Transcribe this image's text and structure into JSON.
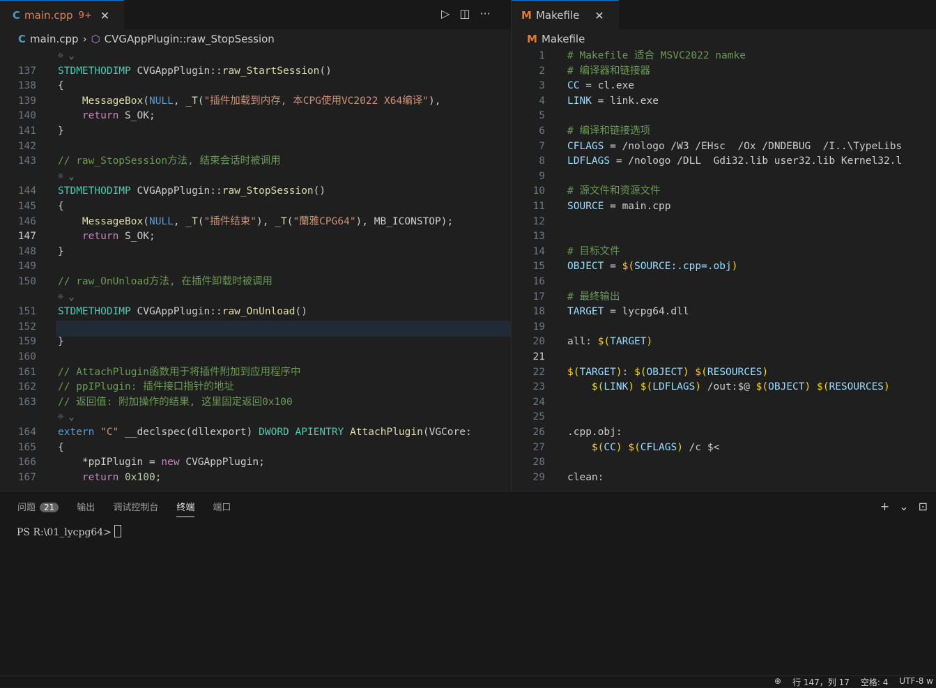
{
  "left_tabs": {
    "active_tab": {
      "icon": "C",
      "label": "main.cpp",
      "badge": "9+",
      "close": "✕"
    }
  },
  "left_breadcrumb": {
    "file": "main.cpp",
    "symbol": "CVGAppPlugin::raw_StopSession"
  },
  "right_tabs": {
    "active_tab": {
      "icon": "M",
      "label": "Makefile",
      "close": "✕"
    }
  },
  "right_breadcrumb": {
    "icon": "M",
    "file": "Makefile"
  },
  "left_lines": [
    {
      "n": "",
      "lens": true
    },
    {
      "n": "137",
      "text": "STDMETHODIMP CVGAppPlugin::raw_StartSession()"
    },
    {
      "n": "138",
      "text": "{"
    },
    {
      "n": "139",
      "text": "    MessageBox(NULL, _T(\"插件加载到内存, 本CPG使用VC2022 X64编译\"),"
    },
    {
      "n": "140",
      "text": "    return S_OK;"
    },
    {
      "n": "141",
      "text": "}"
    },
    {
      "n": "142",
      "text": ""
    },
    {
      "n": "143",
      "text": "// raw_StopSession方法, 结束会话时被调用"
    },
    {
      "n": "",
      "lens": true
    },
    {
      "n": "144",
      "text": "STDMETHODIMP CVGAppPlugin::raw_StopSession()"
    },
    {
      "n": "145",
      "text": "{"
    },
    {
      "n": "146",
      "text": "    MessageBox(NULL, _T(\"插件结束\"), _T(\"蘭雅CPG64\"), MB_ICONSTOP);"
    },
    {
      "n": "147",
      "text": "    return S_OK;"
    },
    {
      "n": "148",
      "text": "}"
    },
    {
      "n": "149",
      "text": ""
    },
    {
      "n": "150",
      "text": "// raw_OnUnload方法, 在插件卸载时被调用"
    },
    {
      "n": "",
      "lens": true
    },
    {
      "n": "151",
      "text": "STDMETHODIMP CVGAppPlugin::raw_OnUnload()"
    },
    {
      "n": "152",
      "text": "{ ···"
    },
    {
      "n": "159",
      "text": "}"
    },
    {
      "n": "160",
      "text": ""
    },
    {
      "n": "161",
      "text": "// AttachPlugin函数用于将插件附加到应用程序中"
    },
    {
      "n": "162",
      "text": "// ppIPlugin: 插件接口指针的地址"
    },
    {
      "n": "163",
      "text": "// 返回值: 附加操作的结果, 这里固定返回0x100"
    },
    {
      "n": "",
      "lens": true
    },
    {
      "n": "164",
      "text": "extern \"C\" __declspec(dllexport) DWORD APIENTRY AttachPlugin(VGCore:"
    },
    {
      "n": "165",
      "text": "{"
    },
    {
      "n": "166",
      "text": "    *ppIPlugin = new CVGAppPlugin;"
    },
    {
      "n": "167",
      "text": "    return 0x100;"
    }
  ],
  "right_lines": [
    {
      "n": "1",
      "text": "# Makefile 适合 MSVC2022 namke"
    },
    {
      "n": "2",
      "text": "# 编译器和链接器"
    },
    {
      "n": "3",
      "text": "CC = cl.exe"
    },
    {
      "n": "4",
      "text": "LINK = link.exe"
    },
    {
      "n": "5",
      "text": ""
    },
    {
      "n": "6",
      "text": "# 编译和链接选项"
    },
    {
      "n": "7",
      "text": "CFLAGS = /nologo /W3 /EHsc  /Ox /DNDEBUG  /I..\\TypeLibs"
    },
    {
      "n": "8",
      "text": "LDFLAGS = /nologo /DLL  Gdi32.lib user32.lib Kernel32.l"
    },
    {
      "n": "9",
      "text": ""
    },
    {
      "n": "10",
      "text": "# 源文件和资源文件"
    },
    {
      "n": "11",
      "text": "SOURCE = main.cpp"
    },
    {
      "n": "12",
      "text": ""
    },
    {
      "n": "13",
      "text": ""
    },
    {
      "n": "14",
      "text": "# 目标文件"
    },
    {
      "n": "15",
      "text": "OBJECT = $(SOURCE:.cpp=.obj)"
    },
    {
      "n": "16",
      "text": ""
    },
    {
      "n": "17",
      "text": "# 最终输出"
    },
    {
      "n": "18",
      "text": "TARGET = lycpg64.dll"
    },
    {
      "n": "19",
      "text": ""
    },
    {
      "n": "20",
      "text": "all: $(TARGET)"
    },
    {
      "n": "21",
      "text": ""
    },
    {
      "n": "22",
      "text": "$(TARGET): $(OBJECT) $(RESOURCES)"
    },
    {
      "n": "23",
      "text": "    $(LINK) $(LDFLAGS) /out:$@ $(OBJECT) $(RESOURCES)"
    },
    {
      "n": "24",
      "text": ""
    },
    {
      "n": "25",
      "text": ""
    },
    {
      "n": "26",
      "text": ".cpp.obj:"
    },
    {
      "n": "27",
      "text": "    $(CC) $(CFLAGS) /c $<"
    },
    {
      "n": "28",
      "text": ""
    },
    {
      "n": "29",
      "text": "clean:"
    }
  ],
  "panel": {
    "tabs": [
      "问题",
      "输出",
      "调试控制台",
      "终端",
      "端口"
    ],
    "problems_count": "21",
    "active_tab": "终端",
    "terminal_prompt": "PS R:\\01_lycpg64>"
  },
  "status_bar": {
    "position": "行 147，列 17",
    "indent": "空格: 4",
    "encoding": "UTF-8 w"
  },
  "colors": {
    "accent": "#0078d4",
    "tab_label_left": "#e2835a"
  }
}
